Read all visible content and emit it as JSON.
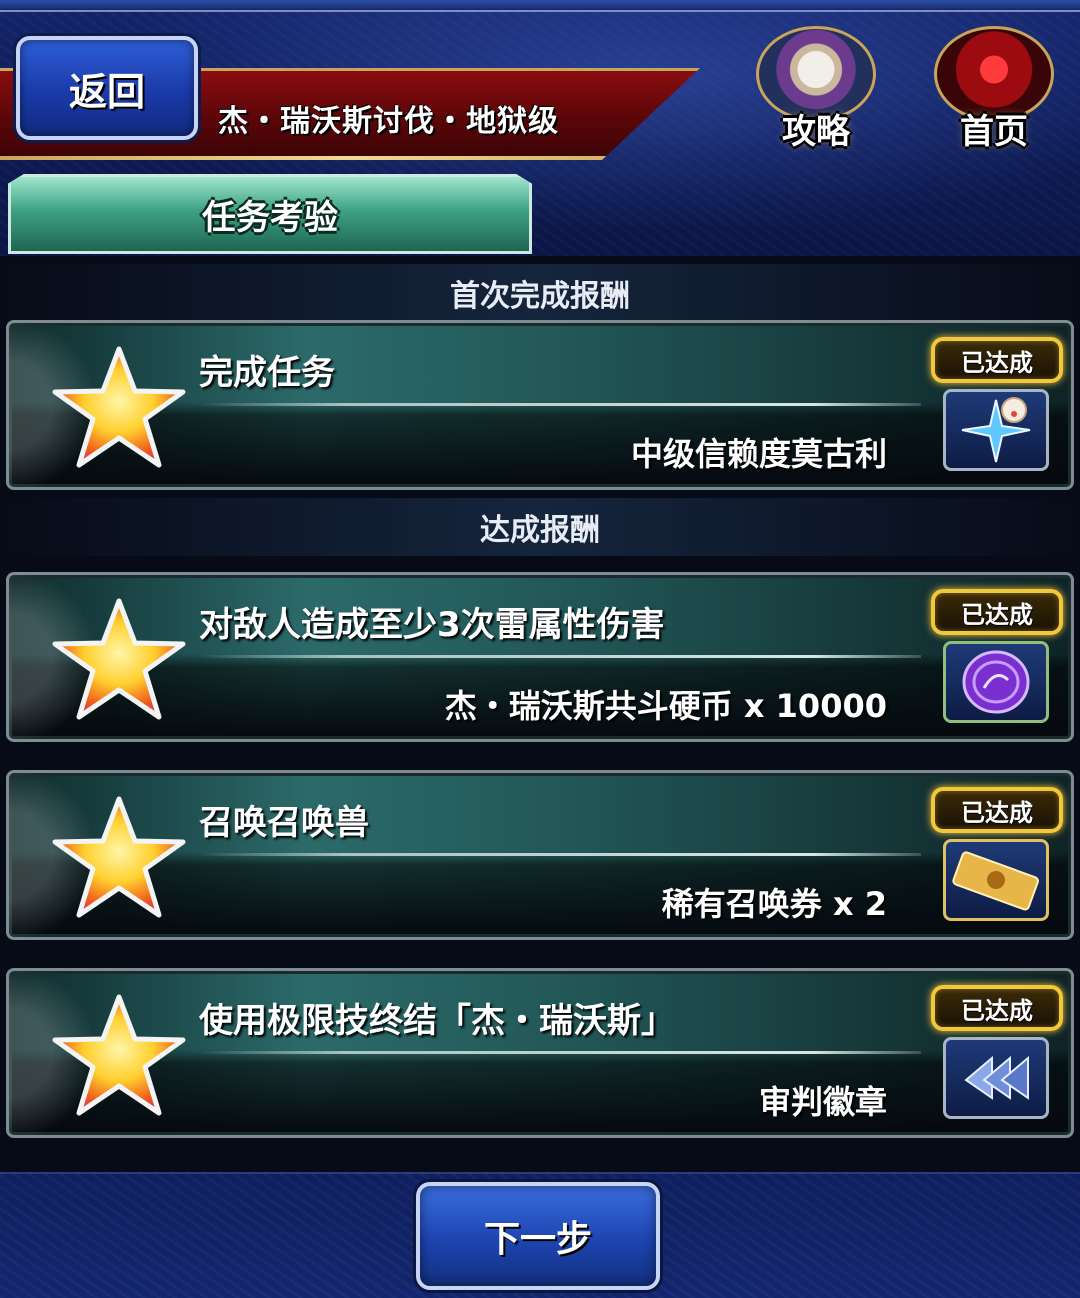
{
  "header": {
    "back_label": "返回",
    "quest_title": "杰・瑞沃斯讨伐・地狱级",
    "guide_label": "攻略",
    "home_label": "首页",
    "tab_label": "任务考验"
  },
  "sections": {
    "first_clear": "首次完成报酬",
    "achievement": "达成报酬"
  },
  "tasks": [
    {
      "title": "完成任务",
      "reward": "中级信赖度莫古利",
      "status": "已达成",
      "icon": "moogle-crystal-icon"
    },
    {
      "title": "对敌人造成至少3次雷属性伤害",
      "reward": "杰・瑞沃斯共斗硬币 x 10000",
      "status": "已达成",
      "icon": "purple-coin-icon"
    },
    {
      "title": "召唤召唤兽",
      "reward": "稀有召唤券 x 2",
      "status": "已达成",
      "icon": "summon-ticket-icon"
    },
    {
      "title": "使用极限技终结「杰・瑞沃斯」",
      "reward": "审判徽章",
      "status": "已达成",
      "icon": "judgment-badge-icon"
    }
  ],
  "footer": {
    "next_label": "下一步"
  },
  "colors": {
    "tab_green": "#3ea184",
    "badge_gold": "#f3c73a",
    "button_blue": "#1d44b0",
    "ribbon_red": "#8a0d10"
  }
}
